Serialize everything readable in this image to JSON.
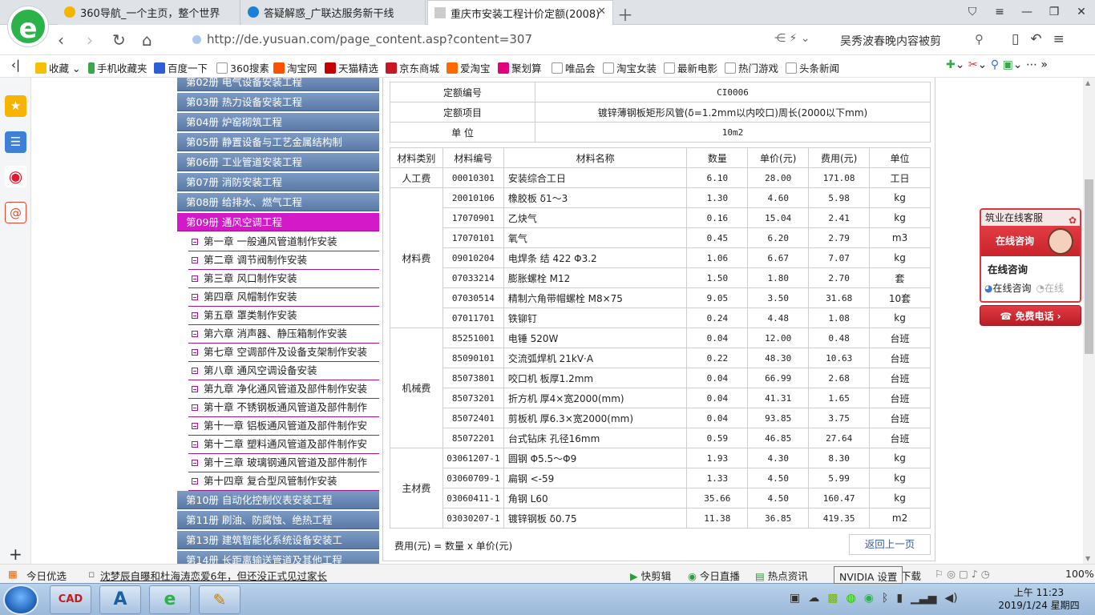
{
  "browser": {
    "tabs": [
      {
        "label": "360导航_一个主页，整个世界",
        "icon_color": "#f5b400"
      },
      {
        "label": "答疑解惑_广联达服务新干线",
        "icon_color": "#1e7fd8"
      },
      {
        "label": "重庆市安装工程计价定额(2008)",
        "icon_color": "#cccccc"
      }
    ],
    "url": "http://de.yusuan.com/page_content.asp?content=307",
    "search_text": "吴秀波春晚内容被剪",
    "bookmarks": [
      "收藏",
      "手机收藏夹",
      "百度一下",
      "360搜素",
      "淘宝网",
      "天猫精选",
      "京东商城",
      "爱淘宝",
      "聚划算",
      "唯品会",
      "淘宝女装",
      "最新电影",
      "热门游戏",
      "头条新闻"
    ]
  },
  "side_menu": {
    "volumes_top": [
      "第02册 电气设备安装工程",
      "第03册 热力设备安装工程",
      "第04册 炉窑砌筑工程",
      "第05册 静置设备与工艺金属结构制",
      "第06册 工业管道安装工程",
      "第07册 消防安装工程",
      "第08册 给排水、燃气工程"
    ],
    "active_volume": "第09册 通风空调工程",
    "chapters": [
      "第一章 一般通风管道制作安装",
      "第二章 调节阀制作安装",
      "第三章 风口制作安装",
      "第四章 风帽制作安装",
      "第五章 罩类制作安装",
      "第六章 消声器、静压箱制作安装",
      "第七章 空调部件及设备支架制作安装",
      "第八章 通风空调设备安装",
      "第九章 净化通风管道及部件制作安装",
      "第十章 不锈钢板通风管道及部件制作",
      "第十一章 铝板通风管道及部件制作安",
      "第十二章 塑料通风管道及部件制作安",
      "第十三章 玻璃钢通风管道及部件制作",
      "第十四章 复合型风管制作安装"
    ],
    "volumes_bottom": [
      "第10册 自动化控制仪表安装工程",
      "第11册 刷油、防腐蚀、绝热工程",
      "第13册 建筑智能化系统设备安装工",
      "第14册 长距离输送管道及其他工程"
    ]
  },
  "quota": {
    "labels": {
      "code": "定额编号",
      "item": "定额项目",
      "unit": "单 位"
    },
    "code": "CI0006",
    "item": "镀锌薄钢板矩形风管(δ=1.2mm以内咬口)周长(2000以下mm)",
    "unit": "10m2"
  },
  "materials": {
    "headers": [
      "材料类别",
      "材料编号",
      "材料名称",
      "数量",
      "单价(元)",
      "费用(元)",
      "单位"
    ],
    "groups": [
      {
        "category": "人工费",
        "rows": [
          [
            "00010301",
            "安装综合工日",
            "6.10",
            "28.00",
            "171.08",
            "工日"
          ]
        ]
      },
      {
        "category": "材料费",
        "rows": [
          [
            "20010106",
            "橡胶板 δ1～3",
            "1.30",
            "4.60",
            "5.98",
            "kg"
          ],
          [
            "17070901",
            "乙炔气",
            "0.16",
            "15.04",
            "2.41",
            "kg"
          ],
          [
            "17070101",
            "氧气",
            "0.45",
            "6.20",
            "2.79",
            "m3"
          ],
          [
            "09010204",
            "电焊条 结 422 Φ3.2",
            "1.06",
            "6.67",
            "7.07",
            "kg"
          ],
          [
            "07033214",
            "膨胀螺栓 M12",
            "1.50",
            "1.80",
            "2.70",
            "套"
          ],
          [
            "07030514",
            "精制六角带帽螺栓 M8×75",
            "9.05",
            "3.50",
            "31.68",
            "10套"
          ],
          [
            "07011701",
            "铁铆钉",
            "0.24",
            "4.48",
            "1.08",
            "kg"
          ]
        ]
      },
      {
        "category": "机械费",
        "rows": [
          [
            "85251001",
            "电锤 520W",
            "0.04",
            "12.00",
            "0.48",
            "台班"
          ],
          [
            "85090101",
            "交流弧焊机 21kV·A",
            "0.22",
            "48.30",
            "10.63",
            "台班"
          ],
          [
            "85073801",
            "咬口机 板厚1.2mm",
            "0.04",
            "66.99",
            "2.68",
            "台班"
          ],
          [
            "85073201",
            "折方机 厚4×宽2000(mm)",
            "0.04",
            "41.31",
            "1.65",
            "台班"
          ],
          [
            "85072401",
            "剪板机 厚6.3×宽2000(mm)",
            "0.04",
            "93.85",
            "3.75",
            "台班"
          ],
          [
            "85072201",
            "台式钻床 孔径16mm",
            "0.59",
            "46.85",
            "27.64",
            "台班"
          ]
        ]
      },
      {
        "category": "主材费",
        "rows": [
          [
            "03061207-1",
            "圆钢 Φ5.5～Φ9",
            "1.93",
            "4.30",
            "8.30",
            "kg"
          ],
          [
            "03060709-1",
            "扁钢 <-59",
            "1.33",
            "4.50",
            "5.99",
            "kg"
          ],
          [
            "03060411-1",
            "角钢 L60",
            "35.66",
            "4.50",
            "160.47",
            "kg"
          ],
          [
            "03030207-1",
            "镀锌钢板 δ0.75",
            "11.38",
            "36.85",
            "419.35",
            "m2"
          ]
        ]
      }
    ],
    "formula": "费用(元) = 数量 x 单价(元)",
    "back_button": "返回上一页"
  },
  "customer_service": {
    "header": "筑业在线客服",
    "banner": "在线咨询",
    "title": "在线咨询",
    "online_link": "在线咨询",
    "offline_label": "在线",
    "phone_button": "免费电话"
  },
  "status_bar": {
    "left_label": "今日优选",
    "news": "沈梦辰自曝和杜海涛恋爱6年，但还没正式见过家长",
    "items": [
      "快剪辑",
      "今日直播",
      "热点资讯",
      "下载"
    ],
    "zoom": "100%"
  },
  "tooltip": "NVIDIA 设置",
  "taskbar": {
    "apps": [
      "CAD",
      "A",
      "e",
      "✎"
    ],
    "time": "上午 11:23",
    "date": "2019/1/24 星期四"
  }
}
